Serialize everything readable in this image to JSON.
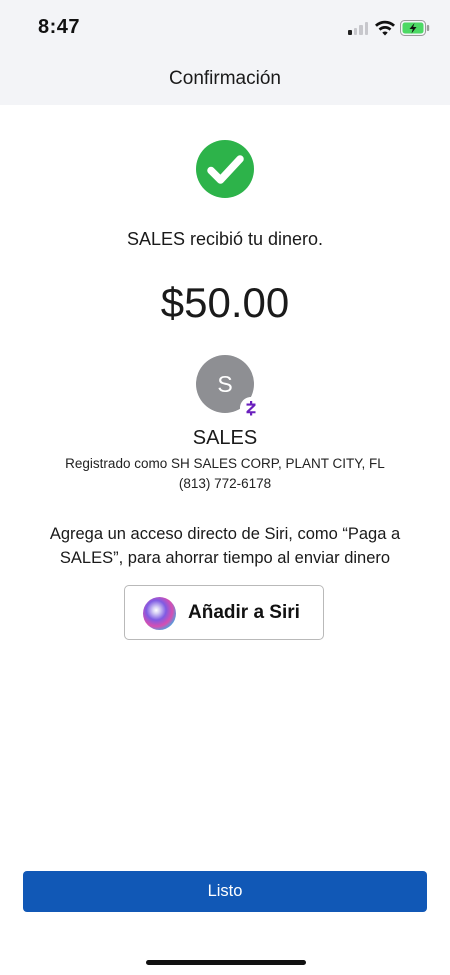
{
  "status_bar": {
    "time": "8:47",
    "signal_icon": "cellular-signal-icon",
    "wifi_icon": "wifi-icon",
    "battery_icon": "battery-charging-icon",
    "battery_color": "#4cd964"
  },
  "nav": {
    "title": "Confirmación"
  },
  "confirmation": {
    "icon": "check-circle-icon",
    "icon_color": "#2db34a",
    "message": "SALES recibió tu dinero.",
    "amount": "$50.00"
  },
  "recipient": {
    "avatar_initial": "S",
    "avatar_color": "#8e8f93",
    "badge_icon": "cash-app-badge-icon",
    "badge_color": "#6a1fbd",
    "name": "SALES",
    "registered_as": "Registrado como SH SALES CORP, PLANT CITY, FL",
    "phone": "(813) 772-6178"
  },
  "siri": {
    "prompt": "Agrega un acceso directo de Siri, como “Paga a SALES”, para ahorrar tiempo al enviar dinero",
    "button_label": "Añadir a Siri",
    "icon": "siri-icon"
  },
  "footer": {
    "done_label": "Listo",
    "done_color": "#1158b6"
  }
}
